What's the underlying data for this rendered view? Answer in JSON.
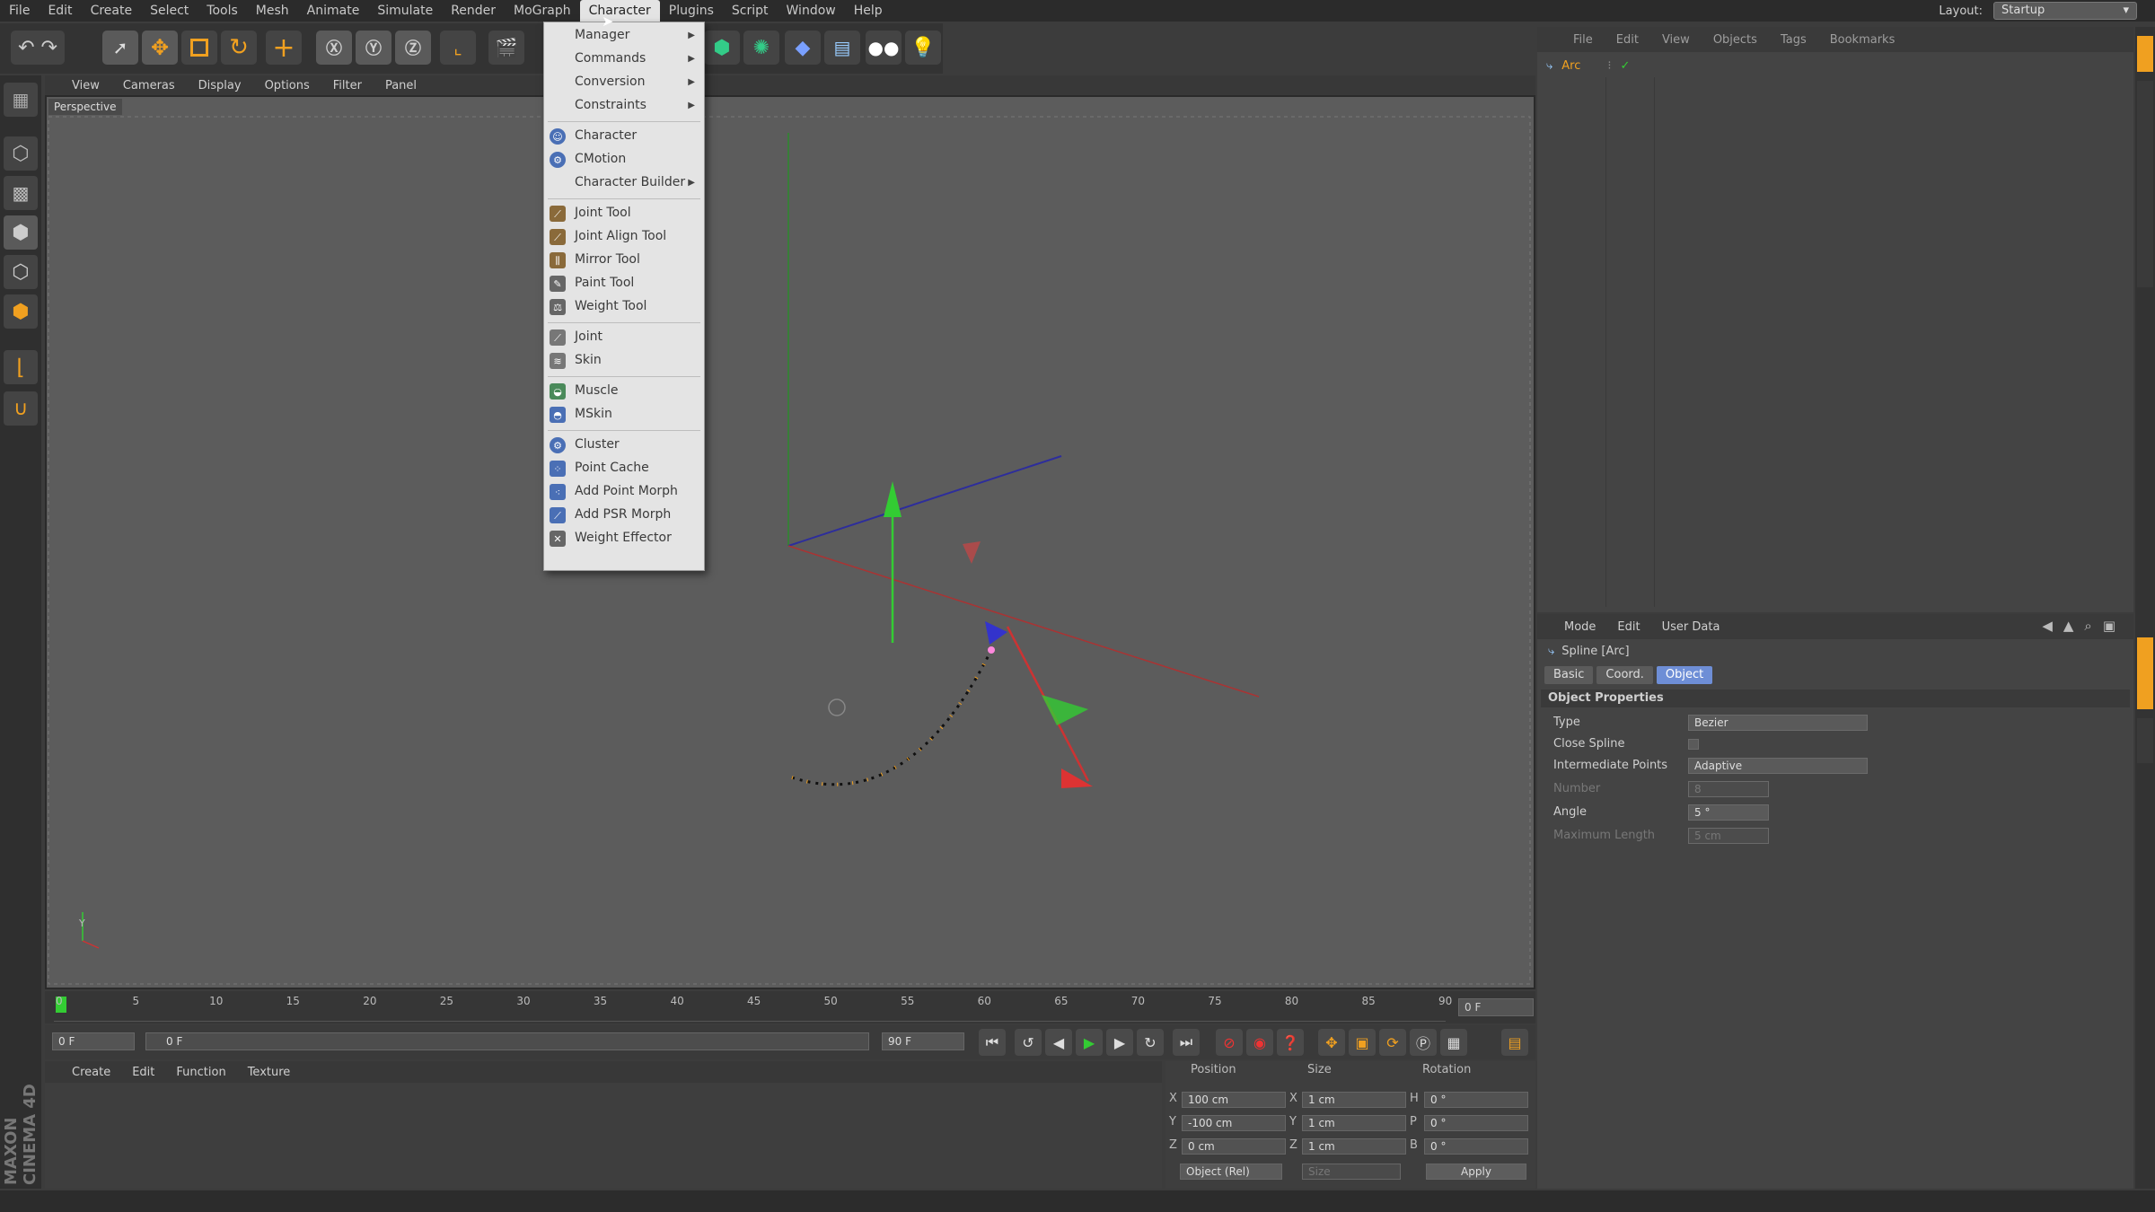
{
  "menubar": {
    "items": [
      "File",
      "Edit",
      "Create",
      "Select",
      "Tools",
      "Mesh",
      "Animate",
      "Simulate",
      "Render",
      "MoGraph",
      "Character",
      "Plugins",
      "Script",
      "Window",
      "Help"
    ],
    "active": "Character"
  },
  "layout": {
    "label": "Layout:",
    "value": "Startup"
  },
  "viewport": {
    "menu": [
      "View",
      "Cameras",
      "Display",
      "Options",
      "Filter",
      "Panel"
    ],
    "camera_label": "Perspective",
    "axis_y": "Y"
  },
  "character_menu": {
    "submenus": [
      "Manager",
      "Commands",
      "Conversion",
      "Constraints"
    ],
    "group1": [
      "Character",
      "CMotion",
      "Character Builder"
    ],
    "group2": [
      "Joint Tool",
      "Joint Align Tool",
      "Mirror Tool",
      "Paint Tool",
      "Weight Tool"
    ],
    "group3": [
      "Joint",
      "Skin"
    ],
    "group4": [
      "Muscle",
      "MSkin"
    ],
    "group5": [
      "Cluster",
      "Point Cache",
      "Add Point Morph",
      "Add PSR Morph",
      "Weight Effector"
    ]
  },
  "object_manager": {
    "menu": [
      "File",
      "Edit",
      "View",
      "Objects",
      "Tags",
      "Bookmarks"
    ],
    "object_name": "Arc"
  },
  "attributes": {
    "menu": [
      "Mode",
      "Edit",
      "User Data"
    ],
    "object_title": "Spline [Arc]",
    "tabs": [
      "Basic",
      "Coord.",
      "Object"
    ],
    "selected_tab": "Object",
    "section": "Object Properties",
    "props": [
      {
        "label": "Type",
        "value": "Bezier"
      },
      {
        "label": "Close Spline",
        "value": ""
      },
      {
        "label": "Intermediate Points",
        "value": "Adaptive"
      },
      {
        "label": "Number",
        "value": "8"
      },
      {
        "label": "Angle",
        "value": "5 °"
      },
      {
        "label": "Maximum Length",
        "value": "5 cm"
      }
    ]
  },
  "timeline": {
    "ticks": [
      "0",
      "5",
      "10",
      "15",
      "20",
      "25",
      "30",
      "35",
      "40",
      "45",
      "50",
      "55",
      "60",
      "65",
      "70",
      "75",
      "80",
      "85",
      "90"
    ],
    "current_frame": "0 F"
  },
  "playback": {
    "start": "0 F",
    "range_start": "0 F",
    "range_end": "90 F",
    "end": "90 F"
  },
  "material_manager": {
    "menu": [
      "Create",
      "Edit",
      "Function",
      "Texture"
    ]
  },
  "coordinates": {
    "headers": [
      "Position",
      "Size",
      "Rotation"
    ],
    "rows": [
      {
        "axis": "X",
        "pos": "100 cm",
        "size_axis": "X",
        "size": "1 cm",
        "rot_axis": "H",
        "rot": "0 °"
      },
      {
        "axis": "Y",
        "pos": "-100 cm",
        "size_axis": "Y",
        "size": "1 cm",
        "rot_axis": "P",
        "rot": "0 °"
      },
      {
        "axis": "Z",
        "pos": "0 cm",
        "size_axis": "Z",
        "size": "1 cm",
        "rot_axis": "B",
        "rot": "0 °"
      }
    ],
    "mode": "Object (Rel)",
    "size_mode": "Size",
    "apply": "Apply"
  },
  "logo": "MAXON CINEMA 4D",
  "colors": {
    "accent": "#6e8ed6",
    "menu_bg": "#e4e4e4",
    "viewport": "#5c5c5c",
    "x_axis": "#d33",
    "y_axis": "#3c3",
    "z_axis": "#33c"
  }
}
